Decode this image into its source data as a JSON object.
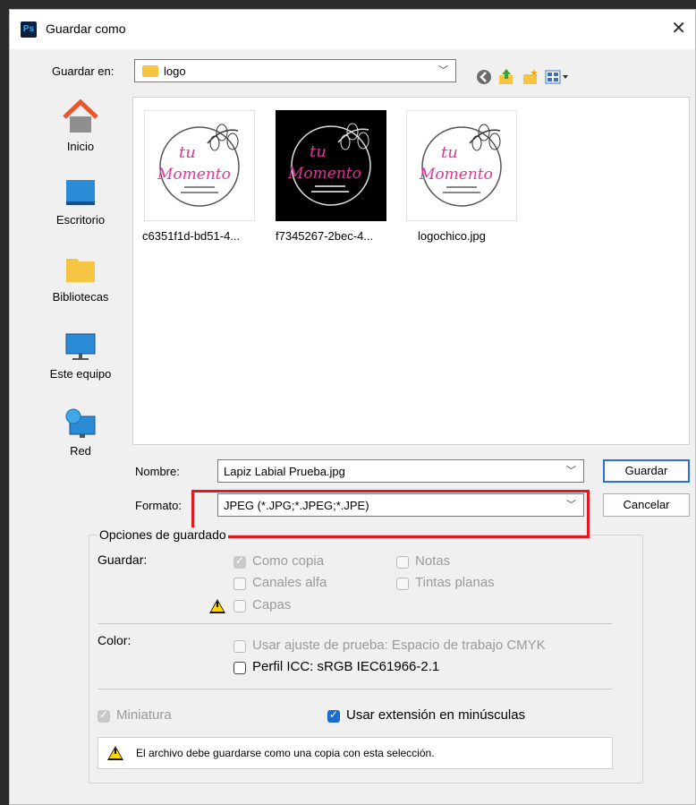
{
  "window": {
    "title": "Guardar como",
    "app_badge": "Ps"
  },
  "save_in": {
    "label": "Guardar en:",
    "value": "logo"
  },
  "places": [
    {
      "label": "Inicio",
      "icon": "home-icon"
    },
    {
      "label": "Escritorio",
      "icon": "desktop-icon"
    },
    {
      "label": "Bibliotecas",
      "icon": "libraries-icon"
    },
    {
      "label": "Este equipo",
      "icon": "computer-icon"
    },
    {
      "label": "Red",
      "icon": "network-icon"
    }
  ],
  "files": [
    {
      "name": "c6351f1d-bd51-4...",
      "thumb_bg": "#ffffff"
    },
    {
      "name": "f7345267-2bec-4...",
      "thumb_bg": "#000000"
    },
    {
      "name": "logochico.jpg",
      "thumb_bg": "#ffffff"
    }
  ],
  "logo_text": {
    "line1": "tu",
    "line2": "Momento"
  },
  "name_field": {
    "label": "Nombre:",
    "value": "Lapiz Labial Prueba.jpg"
  },
  "format_field": {
    "label": "Formato:",
    "value": "JPEG (*.JPG;*.JPEG;*.JPE)"
  },
  "buttons": {
    "save": "Guardar",
    "cancel": "Cancelar"
  },
  "options": {
    "legend": "Opciones de guardado",
    "save_label": "Guardar:",
    "como_copia": "Como copia",
    "notas": "Notas",
    "canales_alfa": "Canales alfa",
    "tintas_planas": "Tintas planas",
    "capas": "Capas",
    "color_label": "Color:",
    "ajuste_prueba": "Usar ajuste de prueba: Espacio de trabajo CMYK",
    "perfil_icc": "Perfil ICC: sRGB IEC61966-2.1",
    "miniatura": "Miniatura",
    "extension": "Usar extensión en minúsculas",
    "warning": "El archivo debe guardarse como una copia con esta selección."
  },
  "colors": {
    "accent": "#1a6cd1",
    "highlight_box": "#e0191e",
    "logo_pink": "#e0359a"
  }
}
